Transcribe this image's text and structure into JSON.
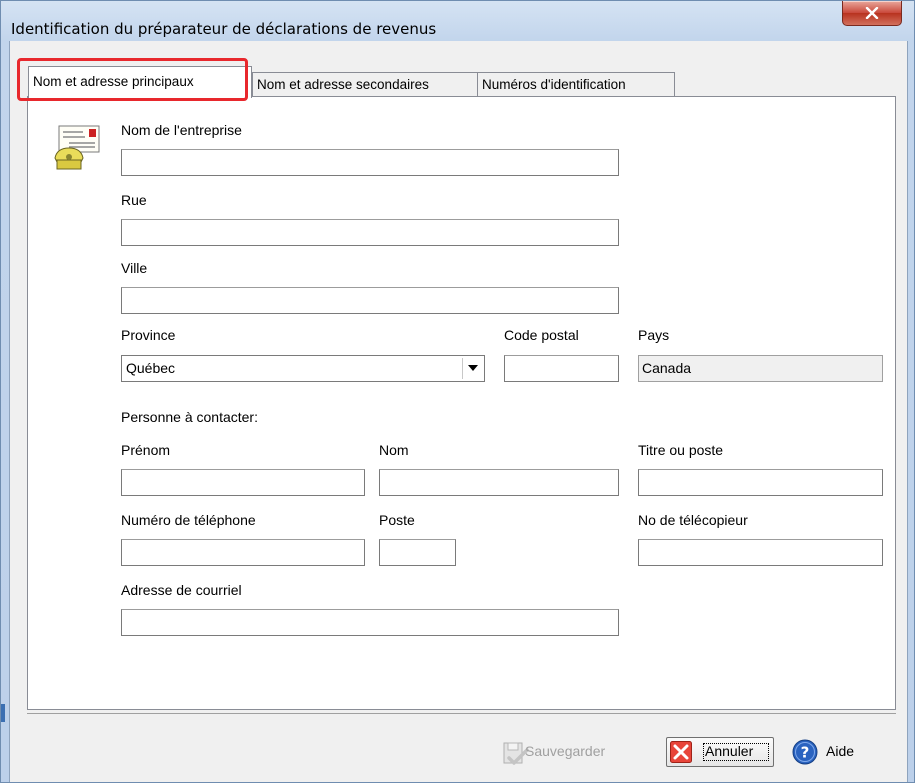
{
  "window": {
    "title": "Identification du préparateur de déclarations de revenus",
    "close_symbol": "x"
  },
  "tabs": [
    {
      "label": "Nom et adresse principaux",
      "active": true
    },
    {
      "label": "Nom et adresse secondaires",
      "active": false
    },
    {
      "label": "Numéros d'identification",
      "active": false
    }
  ],
  "form": {
    "icon": "address-card-phone-icon",
    "company_name": {
      "label": "Nom de l'entreprise",
      "value": ""
    },
    "street": {
      "label": "Rue",
      "value": ""
    },
    "city": {
      "label": "Ville",
      "value": ""
    },
    "province": {
      "label": "Province",
      "value": "Québec"
    },
    "postal_code": {
      "label": "Code postal",
      "value": ""
    },
    "country": {
      "label": "Pays",
      "value": "Canada"
    },
    "contact_heading": "Personne à contacter:",
    "first_name": {
      "label": "Prénom",
      "value": ""
    },
    "last_name": {
      "label": "Nom",
      "value": ""
    },
    "job_title": {
      "label": "Titre ou poste",
      "value": ""
    },
    "phone": {
      "label": "Numéro de téléphone",
      "value": ""
    },
    "extension": {
      "label": "Poste",
      "value": ""
    },
    "fax": {
      "label": "No de télécopieur",
      "value": ""
    },
    "email": {
      "label": "Adresse de courriel",
      "value": ""
    }
  },
  "buttons": {
    "save": {
      "label": "Sauvegarder",
      "enabled": false,
      "icon": "save-check-icon"
    },
    "cancel": {
      "label": "Annuler",
      "icon": "red-x-icon"
    },
    "help": {
      "label": "Aide",
      "icon": "help-question-icon"
    }
  },
  "colors": {
    "highlight": "#e8282d",
    "title_bar": "#c2d5ec",
    "close_button": "#c9473a"
  }
}
